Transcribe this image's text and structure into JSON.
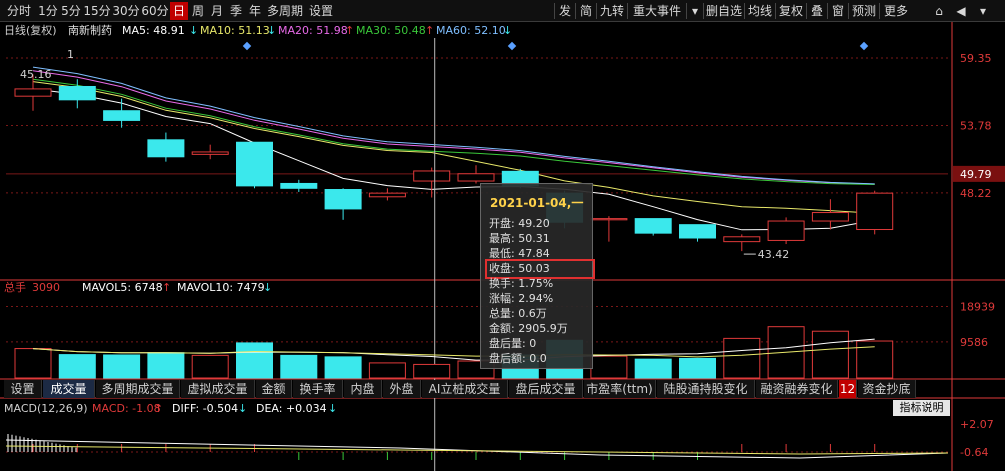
{
  "toolbar": {
    "left": [
      "分时",
      "1分",
      "5分",
      "15分",
      "30分",
      "60分",
      "日",
      "周",
      "月",
      "季",
      "年",
      "多周期",
      "设置"
    ],
    "active": "日",
    "right": [
      "发",
      "简",
      "九转",
      "重大事件",
      "▾",
      "删自选",
      "均线",
      "复权",
      "叠",
      "窗",
      "预测",
      "更多"
    ]
  },
  "colors": {
    "up": "#e03a3a",
    "down": "#3be8ec",
    "ma5": "#ffffff",
    "ma10": "#e8e86a",
    "ma20": "#e86ae8",
    "ma30": "#3ac83a",
    "ma60": "#7fbfff",
    "grid": "#7a1818",
    "axis": "#e03a3a"
  },
  "main_header": {
    "kind": "日线(复权)",
    "stock": "南新制药",
    "ma": [
      {
        "label": "MA5: 48.91",
        "arrow": "↓",
        "color": "#ffffff"
      },
      {
        "label": "MA10: 51.13",
        "arrow": "↓",
        "color": "#e8e86a"
      },
      {
        "label": "MA20: 51.98",
        "arrow": "↑",
        "color": "#e86ae8"
      },
      {
        "label": "MA30: 50.48",
        "arrow": "↑",
        "color": "#3ac83a"
      },
      {
        "label": "MA60: 52.10",
        "arrow": "↓",
        "color": "#7fbfff"
      }
    ]
  },
  "vol_header": {
    "title": "总手",
    "value": "3090",
    "items": [
      {
        "label": "MAVOL5: 6748",
        "arrow": "↑"
      },
      {
        "label": "MAVOL10: 7479",
        "arrow": "↓"
      }
    ]
  },
  "macd_header": {
    "title": "MACD(12,26,9)",
    "items": [
      {
        "label": "MACD: -1.08",
        "arrow": "↑"
      },
      {
        "label": "DIFF: -0.504",
        "arrow": "↓"
      },
      {
        "label": "DEA: +0.034",
        "arrow": "↓"
      }
    ]
  },
  "price_axis": [
    "59.35",
    "53.78",
    "49.79",
    "48.22"
  ],
  "volume_axis": [
    "18939",
    "9586"
  ],
  "macd_axis": [
    "+2.07",
    "-0.64"
  ],
  "annotations": {
    "high": "1",
    "high_label": "45.16",
    "low_label": "43.42"
  },
  "tooltip": {
    "date": "2021-01-04,一",
    "rows": [
      "开盘: 49.20",
      "最高: 50.31",
      "最低: 47.84",
      "收盘: 50.03",
      "换手: 1.75%",
      "涨幅: 2.94%",
      "总量: 0.6万",
      "金额: 2905.9万",
      "盘后量: 0",
      "盘后额: 0.0"
    ]
  },
  "tabs": [
    "设置",
    "成交量",
    "多周期成交量",
    "虚拟成交量",
    "金额",
    "换手率",
    "内盘",
    "外盘",
    "AI立桩成交量",
    "盘后成交量",
    "市盈率(ttm)",
    "陆股通持股变化",
    "融资融券变化",
    "12",
    "资金抄底"
  ],
  "active_tab": "成交量",
  "indicator_button": "指标说明",
  "chart_data": {
    "type": "candlestick",
    "price_range": [
      41.2,
      61.0
    ],
    "candles": [
      {
        "o": 56.2,
        "h": 58.0,
        "l": 55.0,
        "c": 56.8
      },
      {
        "o": 57.0,
        "h": 57.6,
        "l": 55.2,
        "c": 55.9
      },
      {
        "o": 55.0,
        "h": 56.0,
        "l": 53.6,
        "c": 54.2
      },
      {
        "o": 52.6,
        "h": 53.2,
        "l": 50.8,
        "c": 51.2
      },
      {
        "o": 51.4,
        "h": 52.2,
        "l": 51.0,
        "c": 51.6
      },
      {
        "o": 52.4,
        "h": 52.4,
        "l": 48.6,
        "c": 48.8
      },
      {
        "o": 49.0,
        "h": 49.3,
        "l": 48.3,
        "c": 48.6
      },
      {
        "o": 48.5,
        "h": 48.6,
        "l": 46.0,
        "c": 46.9
      },
      {
        "o": 47.9,
        "h": 48.6,
        "l": 47.6,
        "c": 48.2
      },
      {
        "o": 49.2,
        "h": 50.31,
        "l": 47.84,
        "c": 50.03
      },
      {
        "o": 49.2,
        "h": 50.5,
        "l": 49.0,
        "c": 49.8
      },
      {
        "o": 50.0,
        "h": 50.2,
        "l": 48.6,
        "c": 48.8
      },
      {
        "o": 48.2,
        "h": 48.4,
        "l": 45.3,
        "c": 45.8
      },
      {
        "o": 46.0,
        "h": 46.3,
        "l": 44.2,
        "c": 46.1
      },
      {
        "o": 46.1,
        "h": 46.1,
        "l": 44.7,
        "c": 44.9
      },
      {
        "o": 45.6,
        "h": 45.6,
        "l": 44.2,
        "c": 44.5
      },
      {
        "o": 44.2,
        "h": 44.8,
        "l": 43.42,
        "c": 44.6
      },
      {
        "o": 44.3,
        "h": 46.2,
        "l": 44.0,
        "c": 45.9
      },
      {
        "o": 45.9,
        "h": 47.7,
        "l": 45.2,
        "c": 46.6
      },
      {
        "o": 45.2,
        "h": 48.4,
        "l": 44.8,
        "c": 48.2
      }
    ],
    "volume_range": [
      0,
      22000
    ],
    "volumes": [
      7800,
      6200,
      6100,
      6700,
      6000,
      9300,
      6000,
      5600,
      4000,
      3600,
      4500,
      6100,
      10000,
      5800,
      5000,
      5200,
      10500,
      13600,
      12400,
      9800
    ]
  }
}
